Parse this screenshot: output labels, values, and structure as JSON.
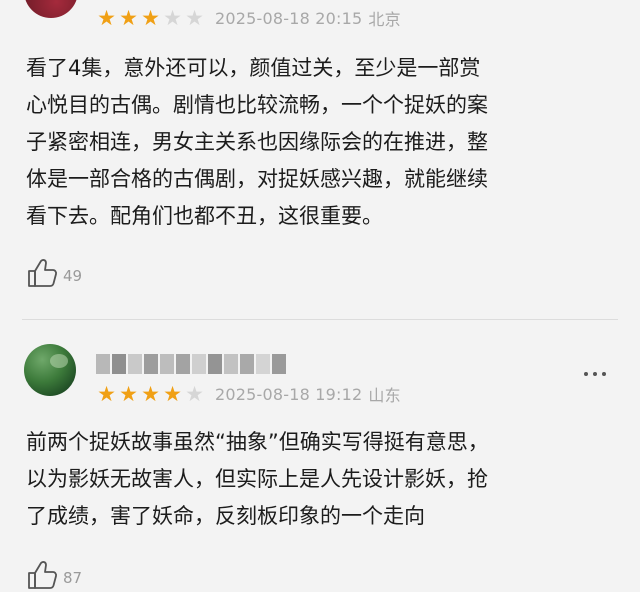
{
  "reviews": [
    {
      "stars": 3,
      "max_stars": 5,
      "date": "2025-08-18 20:15",
      "location": "北京",
      "text": "看了4集，意外还可以，颜值过关，至少是一部赏\n心悦目的古偶。剧情也比较流畅，一个个捉妖的案\n子紧密相连，男女主关系也因缘际会的在推进，整\n体是一部合格的古偶剧，对捉妖感兴趣，就能继续\n看下去。配角们也都不丑，这很重要。",
      "likes": "49"
    },
    {
      "stars": 4,
      "max_stars": 5,
      "date": "2025-08-18 19:12",
      "location": "山东",
      "text": "前两个捉妖故事虽然“抽象”但确实写得挺有意思，\n以为影妖无故害人，但实际上是人先设计影妖，抢\n了成绩，害了妖命，反刻板印象的一个走向",
      "likes": "87"
    }
  ],
  "icons": {
    "rating": "star-icon",
    "like": "thumbs-up-icon",
    "more": "more-dots-icon"
  },
  "colors": {
    "star_on": "#f0a015",
    "star_off": "#d6d6d6",
    "meta_text": "#a8a8a8",
    "background": "#f3f3f3"
  }
}
